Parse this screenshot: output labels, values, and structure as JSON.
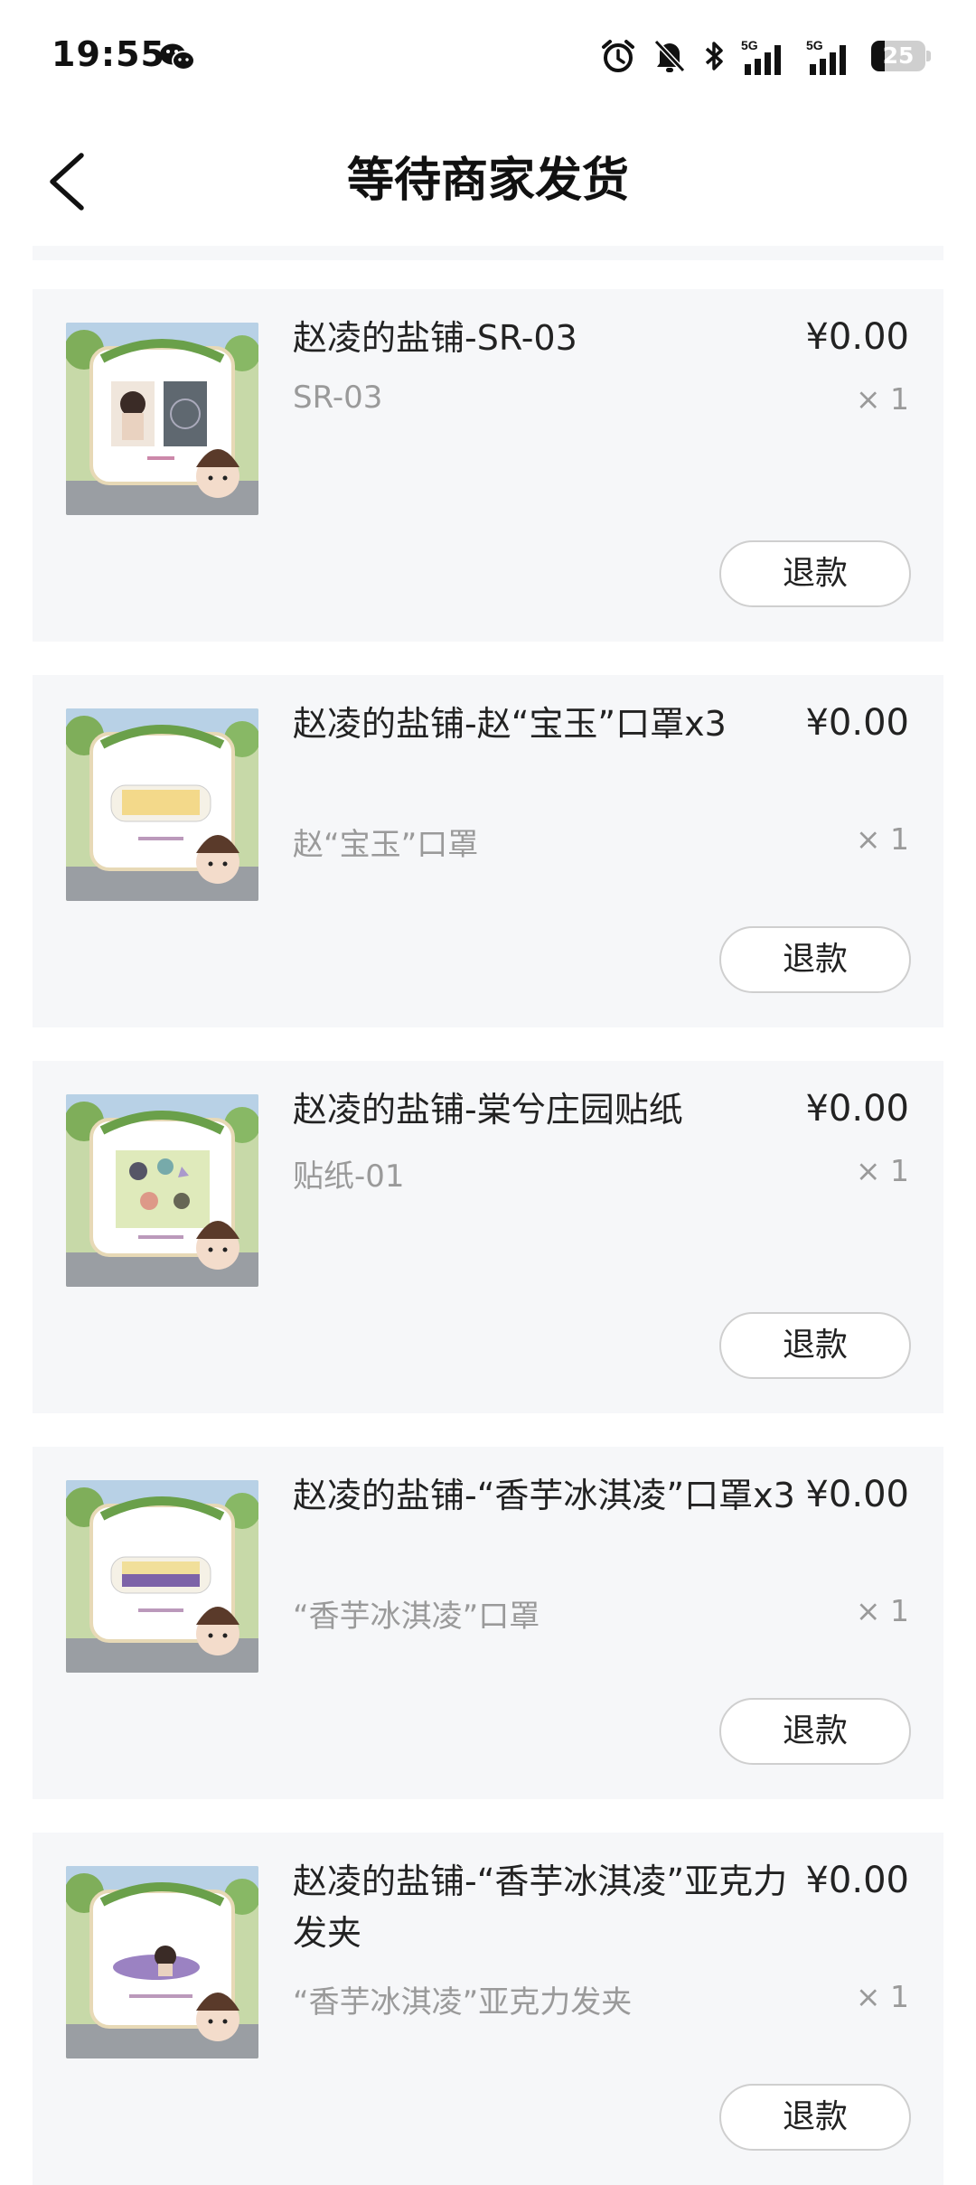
{
  "status_bar": {
    "time": "19:55",
    "battery": "25",
    "battery_level": 0.25
  },
  "header": {
    "title": "等待商家发货"
  },
  "items": [
    {
      "name": "赵凌的盐铺-SR-03",
      "variant": "SR-03",
      "price": "¥0.00",
      "qty": "× 1",
      "refund_label": "退款",
      "thumb_type": "photocard"
    },
    {
      "name": "赵凌的盐铺-赵“宝玉”口罩x3",
      "variant": "赵“宝玉”口罩",
      "price": "¥0.00",
      "qty": "× 1",
      "refund_label": "退款",
      "thumb_type": "mask-yellow"
    },
    {
      "name": "赵凌的盐铺-棠兮庄园贴纸",
      "variant": "贴纸-01",
      "price": "¥0.00",
      "qty": "× 1",
      "refund_label": "退款",
      "thumb_type": "sticker"
    },
    {
      "name": "赵凌的盐铺-“香芋冰淇凌”口罩x3",
      "variant": "“香芋冰淇凌”口罩",
      "price": "¥0.00",
      "qty": "× 1",
      "refund_label": "退款",
      "thumb_type": "mask-purple"
    },
    {
      "name": "赵凌的盐铺-“香芋冰淇凌”亚克力发夹",
      "variant": "“香芋冰淇凌”亚克力发夹",
      "price": "¥0.00",
      "qty": "× 1",
      "refund_label": "退款",
      "thumb_type": "hairclip"
    }
  ]
}
